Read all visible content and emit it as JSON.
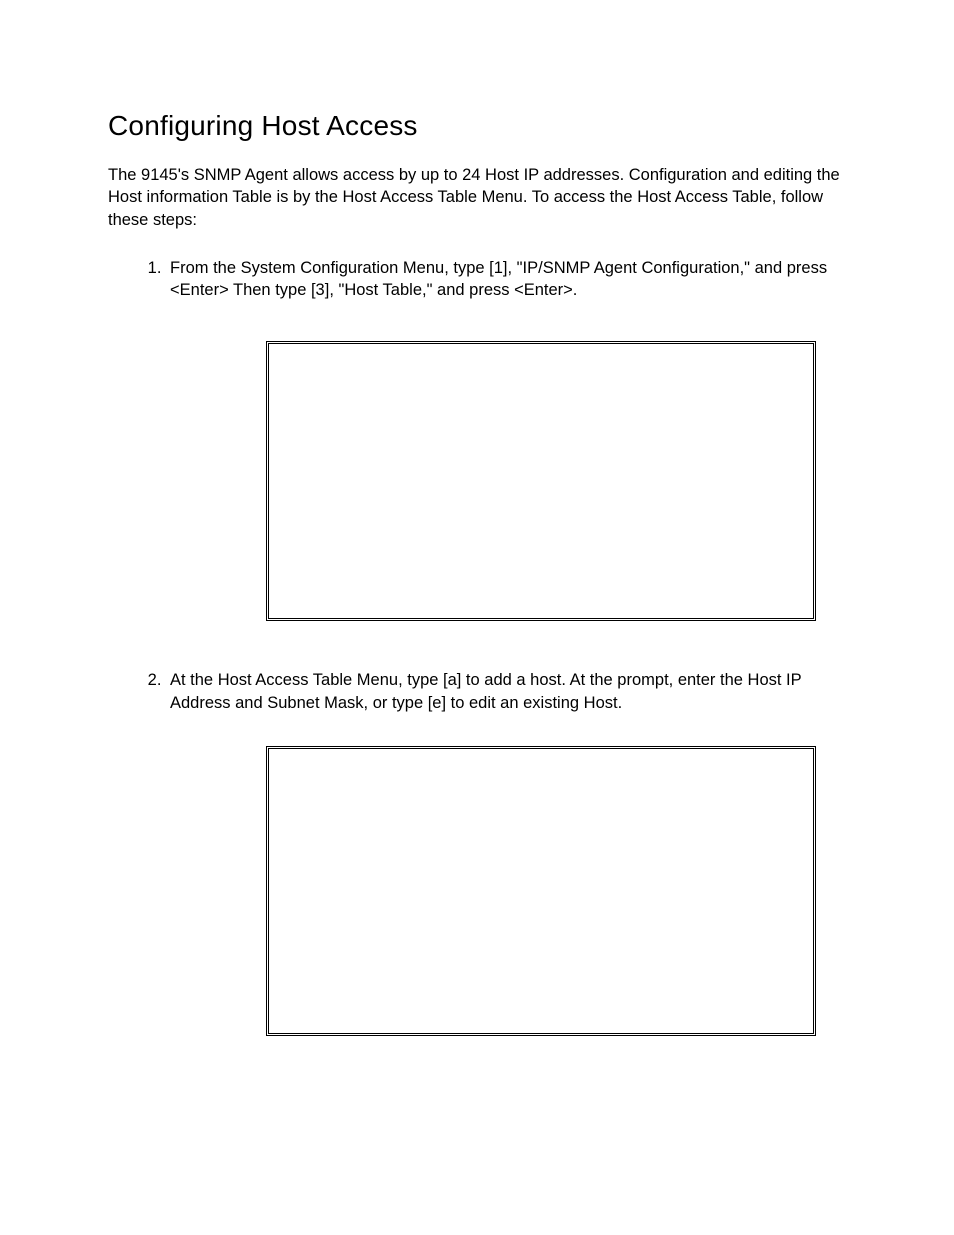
{
  "title": "Configuring Host Access",
  "intro": "The 9145's SNMP Agent allows access by up to 24 Host IP addresses.  Configuration and editing the Host information Table is by the Host Access Table Menu.  To access the Host Access Table, follow these steps:",
  "steps": {
    "s1_a": "From the System Configuration Menu, type [",
    "s1_b": "1",
    "s1_c": "], \"IP/SNMP Agent Configuration,\" and press <Enter>  Then type [",
    "s1_d": "3",
    "s1_e": "], \"Host Table,\" and press <Enter>.",
    "s2": "At the Host Access Table Menu, type [a]  to add a host.  At the prompt, enter the Host IP Address and Subnet Mask, or type [e] to edit an existing Host."
  }
}
